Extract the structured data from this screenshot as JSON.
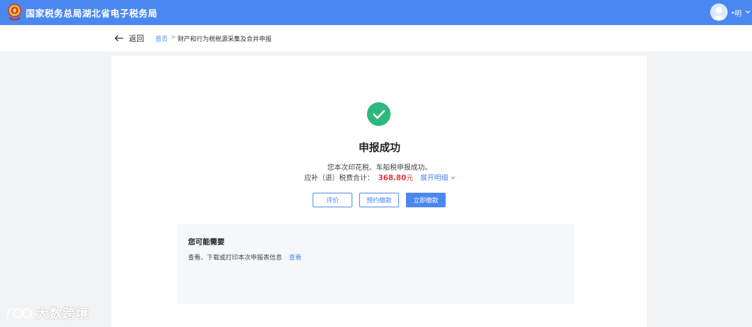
{
  "header": {
    "site_title": "国家税务总局湖北省电子税务局",
    "user_name": "*明",
    "emblem_icon": "tax-emblem-icon",
    "avatar_icon": "user-avatar-icon"
  },
  "nav": {
    "back_label": "返回",
    "breadcrumb": {
      "home": "首页",
      "separator": ">",
      "current": "财产和行为税税源采集及合并申报"
    }
  },
  "result": {
    "status_icon": "check-circle-icon",
    "title": "申报成功",
    "description": "您本次印花税、车船税申报成功。",
    "total_label": "应补（退）税费合计：",
    "total_amount": "368.80",
    "total_unit": "元",
    "expand_label": "展开明细"
  },
  "actions": {
    "rate_label": "评价",
    "reserve_label": "预约缴款",
    "pay_label": "立即缴款"
  },
  "suggestions": {
    "title": "您可能需要",
    "item_text": "查看、下载或打印本次申报表信息",
    "item_link": "查看"
  },
  "watermark": {
    "text": "大数跨境"
  },
  "colors": {
    "primary": "#4b87f0",
    "success": "#2db87d",
    "amount": "#e23a3a",
    "page_bg": "#f2f3f5"
  }
}
